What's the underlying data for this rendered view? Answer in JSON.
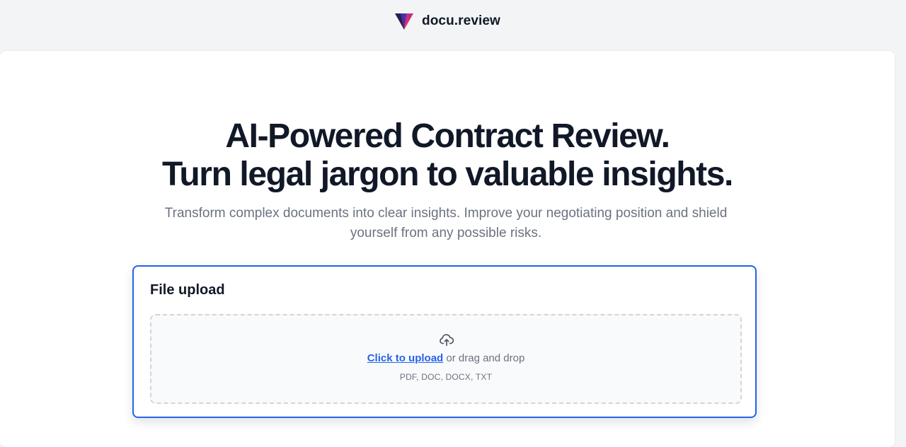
{
  "header": {
    "brand_name": "docu.review",
    "logo_icon": "v-triangle-logo-icon",
    "logo_colors": [
      "#1e1b4b",
      "#4f46e5",
      "#db2777",
      "#f97316"
    ]
  },
  "hero": {
    "title_line1": "AI-Powered Contract Review.",
    "title_line2": "Turn legal jargon to valuable insights.",
    "subtitle": "Transform complex documents into clear insights. Improve your negotiating position and shield yourself from any possible risks."
  },
  "upload": {
    "title": "File upload",
    "icon": "cloud-upload-icon",
    "link_text": "Click to upload",
    "drag_text": " or drag and drop",
    "file_types": "PDF, DOC, DOCX, TXT"
  },
  "colors": {
    "accent": "#2563eb",
    "text_dark": "#111827",
    "text_muted": "#6b7280",
    "page_bg": "#f3f4f6"
  }
}
